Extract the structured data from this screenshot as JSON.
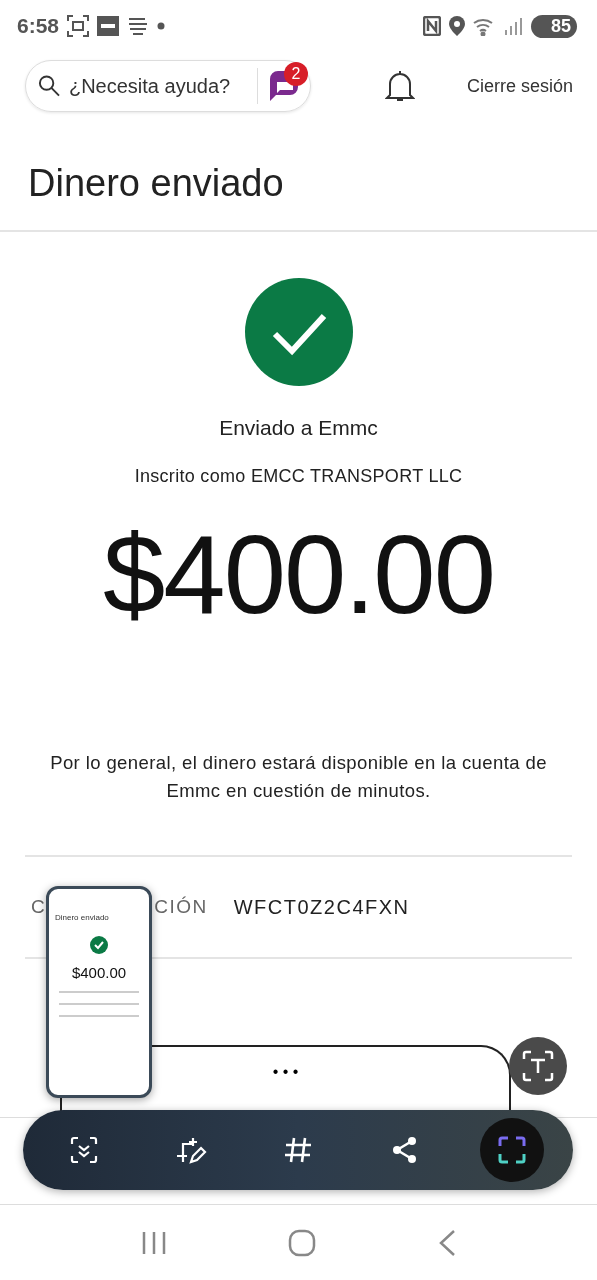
{
  "status_bar": {
    "time": "6:58",
    "battery": "85"
  },
  "header": {
    "search": {
      "placeholder": "¿Necesita ayuda?"
    },
    "chat_badge": "2",
    "logout": "Cierre sesión"
  },
  "title": "Dinero enviado",
  "confirmation": {
    "sent_to": "Enviado a Emmc",
    "enrolled_as": "Inscrito como EMCC TRANSPORT LLC",
    "amount": "$400.00",
    "note": "Por lo general, el dinero estará disponible en la cuenta de Emmc en cuestión de minutos.",
    "code_label_start": "C",
    "code_label_end": "CIÓN",
    "code": "WFCT0Z2C4FXN",
    "button": "• • •"
  },
  "screenshot_preview": {
    "title": "Dinero enviado",
    "amount": "$400.00"
  },
  "screenshot_toolbar": [
    {
      "kind": "scroll"
    },
    {
      "kind": "edit"
    },
    {
      "kind": "tags"
    },
    {
      "kind": "share"
    },
    {
      "kind": "capture",
      "selected": true
    }
  ]
}
